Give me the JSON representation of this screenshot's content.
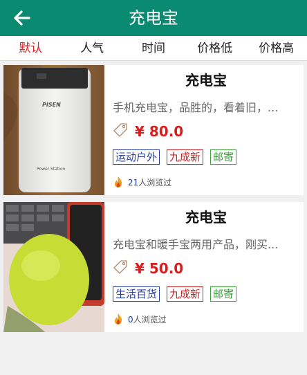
{
  "header": {
    "title": "充电宝",
    "back_icon": "arrow-left-icon"
  },
  "tabs": [
    {
      "label": "默认",
      "active": true
    },
    {
      "label": "人气",
      "active": false
    },
    {
      "label": "时间",
      "active": false
    },
    {
      "label": "价格低",
      "active": false
    },
    {
      "label": "价格高",
      "active": false
    }
  ],
  "products": [
    {
      "name": "充电宝",
      "description": "手机充电宝，品胜的，看着旧，...",
      "price": "¥ 80.0",
      "category_tag": "运动户外",
      "condition_tag": "九成新",
      "shipping_tag": "邮寄",
      "views_count": "21",
      "views_suffix": "人浏览过",
      "image_labels": {
        "brand": "PISEN",
        "model": "Power Station"
      }
    },
    {
      "name": "充电宝",
      "description": "充电宝和暖手宝两用产品，刚买...",
      "price": "¥ 50.0",
      "category_tag": "生活百货",
      "condition_tag": "九成新",
      "shipping_tag": "邮寄",
      "views_count": "0",
      "views_suffix": "人浏览过"
    }
  ],
  "colors": {
    "header_bg": "#0a8a70",
    "active_tab": "#e12020",
    "price": "#d71f1f",
    "tag_blue": "#2a3f9e",
    "tag_red": "#c12424",
    "tag_green": "#3ca13c"
  }
}
